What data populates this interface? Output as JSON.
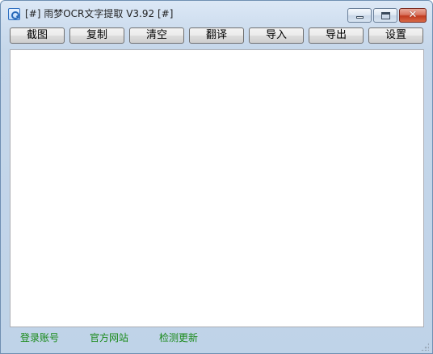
{
  "window": {
    "title": "[#] 雨梦OCR文字提取 V3.92 [#]",
    "icon": "ocr-app-icon",
    "controls": {
      "minimize": "minimize-icon",
      "maximize": "maximize-icon",
      "close_glyph": "✕"
    }
  },
  "toolbar": {
    "buttons": [
      {
        "label": "截图"
      },
      {
        "label": "复制"
      },
      {
        "label": "清空"
      },
      {
        "label": "翻译"
      },
      {
        "label": "导入"
      },
      {
        "label": "导出"
      },
      {
        "label": "设置"
      }
    ]
  },
  "main": {
    "text_value": ""
  },
  "statusbar": {
    "links": [
      {
        "label": "登录账号"
      },
      {
        "label": "官方网站"
      },
      {
        "label": "检测更新"
      }
    ],
    "link_color": "#1a8a1a"
  }
}
